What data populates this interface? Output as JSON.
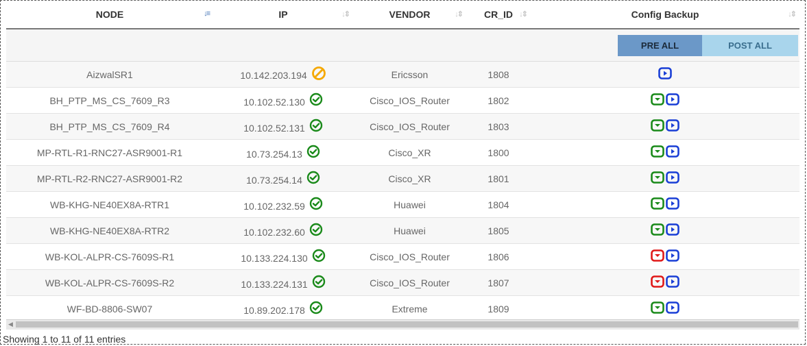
{
  "columns": [
    {
      "label": "NODE",
      "sort": "active"
    },
    {
      "label": "IP",
      "sort": "none"
    },
    {
      "label": "VENDOR",
      "sort": "none"
    },
    {
      "label": "CR_ID",
      "sort": "none"
    },
    {
      "label": "Config Backup",
      "sort": "none"
    }
  ],
  "buttons": {
    "pre_all": "PRE ALL",
    "post_all": "POST ALL"
  },
  "rows": [
    {
      "node": "AizwalSR1",
      "ip": "10.142.203.194",
      "status": "blocked",
      "vendor": "Ericsson",
      "cr_id": "1808",
      "actions": [
        "play"
      ]
    },
    {
      "node": "BH_PTP_MS_CS_7609_R3",
      "ip": "10.102.52.130",
      "status": "ok",
      "vendor": "Cisco_IOS_Router",
      "cr_id": "1802",
      "actions": [
        "down-green",
        "play"
      ]
    },
    {
      "node": "BH_PTP_MS_CS_7609_R4",
      "ip": "10.102.52.131",
      "status": "ok",
      "vendor": "Cisco_IOS_Router",
      "cr_id": "1803",
      "actions": [
        "down-green",
        "play"
      ]
    },
    {
      "node": "MP-RTL-R1-RNC27-ASR9001-R1",
      "ip": "10.73.254.13",
      "status": "ok",
      "vendor": "Cisco_XR",
      "cr_id": "1800",
      "actions": [
        "down-green",
        "play"
      ]
    },
    {
      "node": "MP-RTL-R2-RNC27-ASR9001-R2",
      "ip": "10.73.254.14",
      "status": "ok",
      "vendor": "Cisco_XR",
      "cr_id": "1801",
      "actions": [
        "down-green",
        "play"
      ]
    },
    {
      "node": "WB-KHG-NE40EX8A-RTR1",
      "ip": "10.102.232.59",
      "status": "ok",
      "vendor": "Huawei",
      "cr_id": "1804",
      "actions": [
        "down-green",
        "play"
      ]
    },
    {
      "node": "WB-KHG-NE40EX8A-RTR2",
      "ip": "10.102.232.60",
      "status": "ok",
      "vendor": "Huawei",
      "cr_id": "1805",
      "actions": [
        "down-green",
        "play"
      ]
    },
    {
      "node": "WB-KOL-ALPR-CS-7609S-R1",
      "ip": "10.133.224.130",
      "status": "ok",
      "vendor": "Cisco_IOS_Router",
      "cr_id": "1806",
      "actions": [
        "down-red",
        "play"
      ]
    },
    {
      "node": "WB-KOL-ALPR-CS-7609S-R2",
      "ip": "10.133.224.131",
      "status": "ok",
      "vendor": "Cisco_IOS_Router",
      "cr_id": "1807",
      "actions": [
        "down-red",
        "play"
      ]
    },
    {
      "node": "WF-BD-8806-SW07",
      "ip": "10.89.202.178",
      "status": "ok",
      "vendor": "Extreme",
      "cr_id": "1809",
      "actions": [
        "down-green",
        "play"
      ]
    }
  ],
  "colors": {
    "ok": "#1a8a1a",
    "blocked": "#f5a800",
    "play": "#1a3fd6",
    "down_green": "#1a8a1a",
    "down_red": "#e01818"
  },
  "info": "Showing 1 to 11 of 11 entries"
}
